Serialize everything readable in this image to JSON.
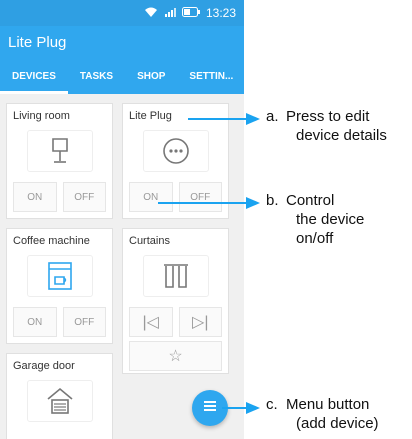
{
  "status": {
    "time": "13:23"
  },
  "app": {
    "title": "Lite Plug"
  },
  "tabs": [
    "DEVICES",
    "TASKS",
    "SHOP",
    "SETTIN..."
  ],
  "devices": [
    {
      "name": "Living room",
      "on_label": "ON",
      "off_label": "OFF"
    },
    {
      "name": "Lite Plug",
      "on_label": "ON",
      "off_label": "OFF"
    },
    {
      "name": "Coffee machine",
      "on_label": "ON",
      "off_label": "OFF"
    },
    {
      "name": "Curtains",
      "prev": "|◁",
      "next": "▷|",
      "fav": "☆"
    },
    {
      "name": "Garage door"
    }
  ],
  "annotations": [
    {
      "letter": "a.",
      "text_line1": "Press to edit",
      "text_line2": "device details"
    },
    {
      "letter": "b.",
      "text_line1": "Control",
      "text_line2": "the device",
      "text_line3": "on/off"
    },
    {
      "letter": "c.",
      "text_line1": "Menu button",
      "text_line2": "(add device)"
    }
  ],
  "colors": {
    "primary": "#30a7ee",
    "arrow": "#1aa3f0"
  }
}
